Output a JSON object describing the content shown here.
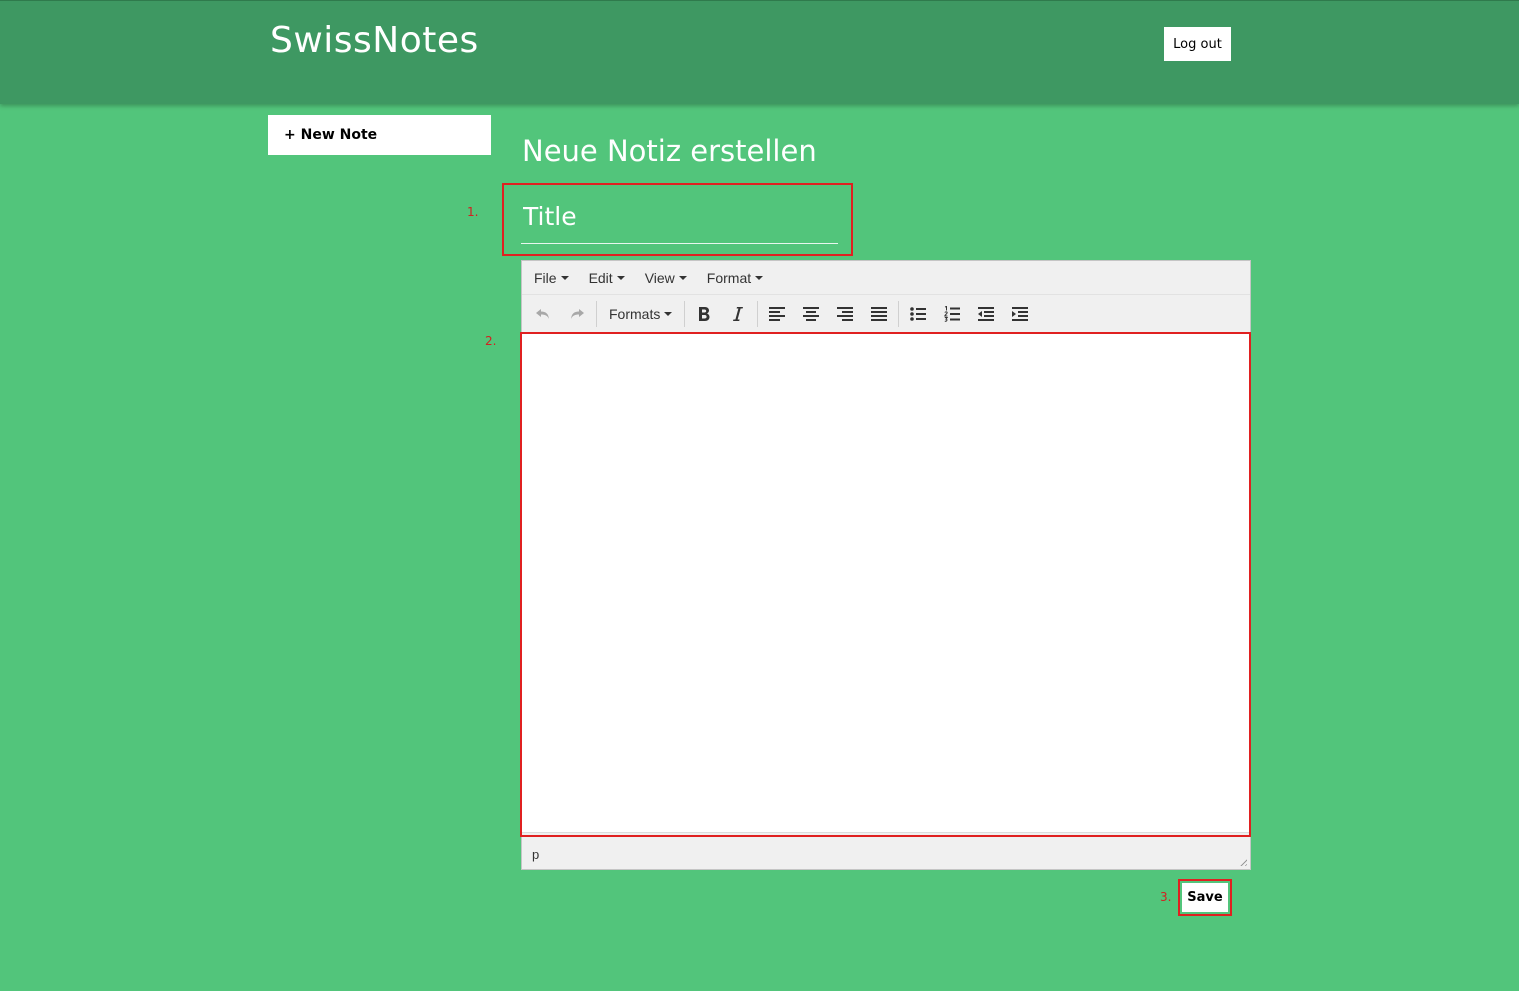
{
  "header": {
    "brand": "SwissNotes",
    "logout_label": "Log out"
  },
  "sidebar": {
    "new_note_label": "+ New Note"
  },
  "main": {
    "heading": "Neue Notiz erstellen",
    "title_placeholder": "Title",
    "save_label": "Save"
  },
  "annotations": {
    "marker_1": "1.",
    "marker_2": "2.",
    "marker_3": "3."
  },
  "editor": {
    "menus": [
      "File",
      "Edit",
      "View",
      "Format"
    ],
    "formats_label": "Formats",
    "status_path": "p",
    "toolbar_icons": [
      "undo-icon",
      "redo-icon",
      "bold-icon",
      "italic-icon",
      "align-left-icon",
      "align-center-icon",
      "align-right-icon",
      "align-justify-icon",
      "bullet-list-icon",
      "numbered-list-icon",
      "outdent-icon",
      "indent-icon"
    ]
  },
  "colors": {
    "background": "#52c57b",
    "header": "#3e9862",
    "annotation_red": "#e02020"
  }
}
